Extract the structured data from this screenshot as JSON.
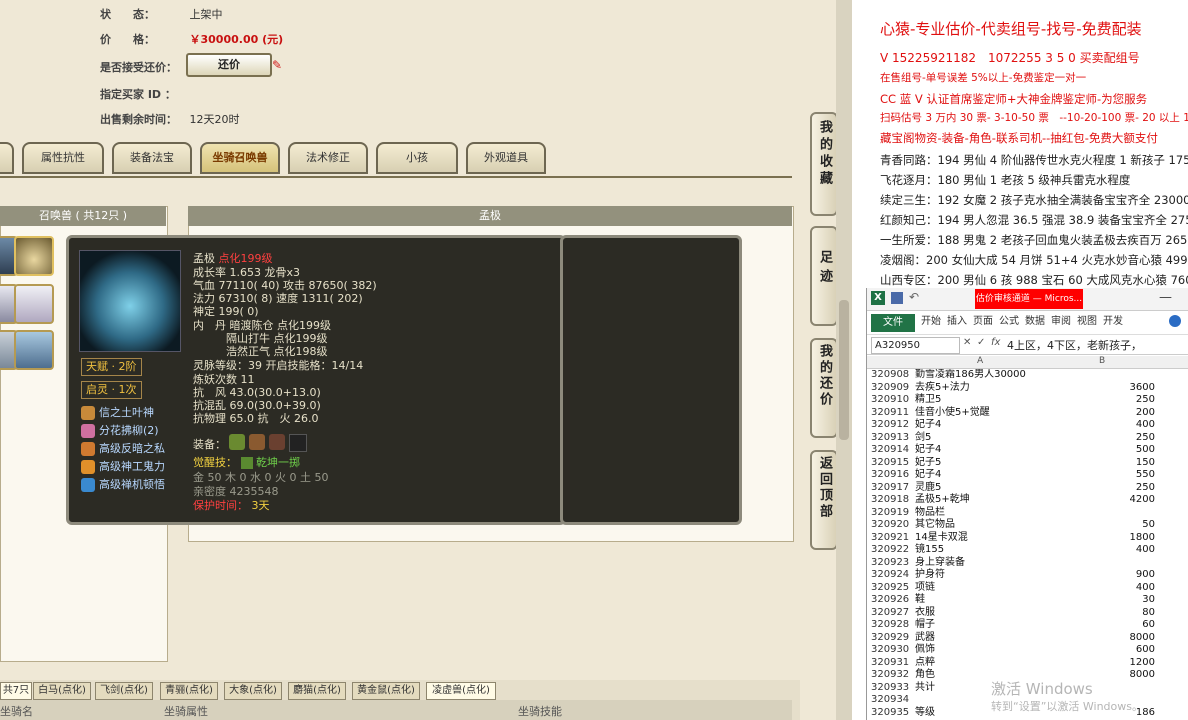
{
  "listing": {
    "status_label": "状　　态：",
    "status_value": "上架中",
    "price_label": "价　　格：",
    "price_value": "￥30000.00 (元)",
    "accept_haggle_label": "是否接受还价：",
    "haggle_button": "还价",
    "buyer_id_label": "指定买家 ID ：",
    "buyer_id_value": "",
    "time_left_label": "出售剩余时间：",
    "time_left_value": "12天20时"
  },
  "tabs": [
    "属性抗性",
    "装备法宝",
    "坐骑召唤兽",
    "法术修正",
    "小孩",
    "外观道具"
  ],
  "active_tab": "坐骑召唤兽",
  "summon_panel": {
    "title": "召唤兽 ( 共12只 )",
    "detail_title": "孟极"
  },
  "tooltip": {
    "name": "孟极",
    "name_tag": "点化199级",
    "growth": "成长率 1.653 龙骨x3",
    "hp": "气血 77110( 40) 攻击 87650( 382)",
    "mp": "法力 67310( 8) 速度 1311( 202)",
    "spirit": "神定 199( 0)",
    "dan1": "内　丹 暗渡陈仓 点化199级",
    "dan2": "　　　隔山打牛 点化199级",
    "dan3": "　　　浩然正气 点化198级",
    "level": "灵脉等级：39 开启技能格：14/14",
    "refine": "炼妖次数 11",
    "res1": "抗　风 43.0(30.0+13.0)",
    "res2": "抗混乱 69.0(30.0+39.0)",
    "res3": "抗物理 65.0 抗　火 26.0",
    "equip_label": "装备：",
    "awaken_label": "觉醒技：",
    "awaken_value": "乾坤一掷",
    "elements": "金 50 木 0 水 0 火 0 土 50",
    "intimacy": "亲密度 4235548",
    "protect_label": "保护时间：",
    "protect_value": "3天",
    "talent": "天赋 · 2阶",
    "spirit2": "启灵 · 1次",
    "skills": [
      "信之土叶神",
      "分花拂柳(2)",
      "高级反暗之私",
      "高级神工鬼力",
      "高级禅机顿悟"
    ]
  },
  "side_buttons": [
    "我的收藏",
    "足迹",
    "我的还价",
    "返回顶部"
  ],
  "bottom": {
    "count_label": "共7只",
    "tabs": [
      "白马(点化)",
      "飞剑(点化)",
      "青骊(点化)",
      "大象(点化)",
      "麝猫(点化)",
      "黄金鼠(点化)",
      "凌虚兽(点化)"
    ],
    "col1": "坐骑名",
    "col2": "坐骑属性",
    "col3": "坐骑技能"
  },
  "right_panel": {
    "title": "心猿-专业估价-代卖组号-找号-免费配装",
    "lines": [
      "V 15225921182　1072255 3 5 0 买卖配组号",
      "在售组号-单号误差 5%以上-免费鉴定一对一",
      "CC 蓝 V 认证首席鉴定师+大神金牌鉴定师-为您服务",
      "扫码估号 3 万内 30 票- 3-10-50 票　--10-20-100 票- 20 以上 150",
      "藏宝阁物资-装备-角色-联系司机--抽红包-免费大额支付"
    ],
    "listings": [
      "青香同路：194 男仙 4 阶仙器传世水克火程度 1 新孩子 17500",
      "飞花逐月：180 男仙 1 老孩 5 级神兵雷克水程度",
      "续定三生：192 女魔 2 孩子克水抽全满装备宝宝齐全 23000",
      "红颜知己：194 男人忽混 36.5 强混 38.9 装备宝宝齐全 27500",
      "一生所爱：188 男鬼 2 老孩子回血鬼火装孟极去疾百万 26500",
      "凌烟阁：200 女仙大成 54 月饼 51+4 火克水妙音心猿 49999",
      "山西专区：200 男仙 6 孩 988 宝石 60 大成风克水心猿 76000"
    ]
  },
  "excel": {
    "title": "估价审核通道 — Micros...",
    "ribbon": [
      "文件",
      "开始",
      "插入",
      "页面",
      "公式",
      "数据",
      "审阅",
      "视图",
      "开发"
    ],
    "name_box": "A320950",
    "formula": "4上区，4下区，老新孩子，",
    "col_a": "A",
    "col_b": "B",
    "rows": [
      {
        "n": "320908",
        "a": "勤雪凌霜186男人30000",
        "b": ""
      },
      {
        "n": "320909",
        "a": "去疾5+法力",
        "b": "3600"
      },
      {
        "n": "320910",
        "a": "精卫5",
        "b": "250"
      },
      {
        "n": "320911",
        "a": "佳音小使5+觉醒",
        "b": "200"
      },
      {
        "n": "320912",
        "a": "妃子4",
        "b": "400"
      },
      {
        "n": "320913",
        "a": "剑5",
        "b": "250"
      },
      {
        "n": "320914",
        "a": "妃子4",
        "b": "500"
      },
      {
        "n": "320915",
        "a": "妃子5",
        "b": "150"
      },
      {
        "n": "320916",
        "a": "妃子4",
        "b": "550"
      },
      {
        "n": "320917",
        "a": "灵鹿5",
        "b": "250"
      },
      {
        "n": "320918",
        "a": "孟极5+乾坤",
        "b": "4200"
      },
      {
        "n": "320919",
        "a": "物品栏",
        "b": ""
      },
      {
        "n": "320920",
        "a": "其它物品",
        "b": "50"
      },
      {
        "n": "320921",
        "a": "14星卡双混",
        "b": "1800"
      },
      {
        "n": "320922",
        "a": "镜155",
        "b": "400"
      },
      {
        "n": "320923",
        "a": "身上穿装备",
        "b": ""
      },
      {
        "n": "320924",
        "a": "护身符",
        "b": "900"
      },
      {
        "n": "320925",
        "a": "项链",
        "b": "400"
      },
      {
        "n": "320926",
        "a": "鞋",
        "b": "30"
      },
      {
        "n": "320927",
        "a": "衣服",
        "b": "80"
      },
      {
        "n": "320928",
        "a": "帽子",
        "b": "60"
      },
      {
        "n": "320929",
        "a": "武器",
        "b": "8000"
      },
      {
        "n": "320930",
        "a": "佩饰",
        "b": "600"
      },
      {
        "n": "320931",
        "a": "点粹",
        "b": "1200"
      },
      {
        "n": "320932",
        "a": "角色",
        "b": "8000"
      },
      {
        "n": "320933",
        "a": "共计",
        "b": ""
      },
      {
        "n": "320934",
        "a": "",
        "b": ""
      },
      {
        "n": "320935",
        "a": "等级",
        "b": "186"
      }
    ]
  },
  "watermark": {
    "line1": "激活 Windows",
    "line2": "转到“设置”以激活 Windows。"
  }
}
